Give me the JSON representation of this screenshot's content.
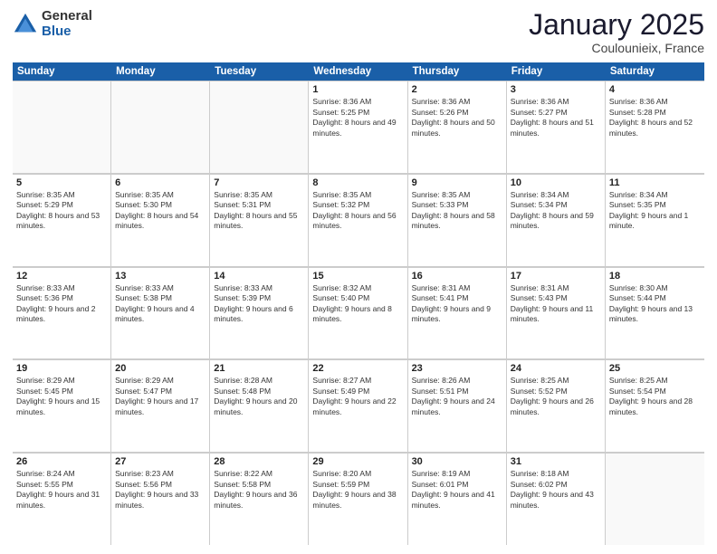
{
  "logo": {
    "general": "General",
    "blue": "Blue"
  },
  "header": {
    "month": "January 2025",
    "location": "Coulounieix, France"
  },
  "weekdays": [
    "Sunday",
    "Monday",
    "Tuesday",
    "Wednesday",
    "Thursday",
    "Friday",
    "Saturday"
  ],
  "rows": [
    [
      {
        "day": "",
        "sunrise": "",
        "sunset": "",
        "daylight": ""
      },
      {
        "day": "",
        "sunrise": "",
        "sunset": "",
        "daylight": ""
      },
      {
        "day": "",
        "sunrise": "",
        "sunset": "",
        "daylight": ""
      },
      {
        "day": "1",
        "sunrise": "Sunrise: 8:36 AM",
        "sunset": "Sunset: 5:25 PM",
        "daylight": "Daylight: 8 hours and 49 minutes."
      },
      {
        "day": "2",
        "sunrise": "Sunrise: 8:36 AM",
        "sunset": "Sunset: 5:26 PM",
        "daylight": "Daylight: 8 hours and 50 minutes."
      },
      {
        "day": "3",
        "sunrise": "Sunrise: 8:36 AM",
        "sunset": "Sunset: 5:27 PM",
        "daylight": "Daylight: 8 hours and 51 minutes."
      },
      {
        "day": "4",
        "sunrise": "Sunrise: 8:36 AM",
        "sunset": "Sunset: 5:28 PM",
        "daylight": "Daylight: 8 hours and 52 minutes."
      }
    ],
    [
      {
        "day": "5",
        "sunrise": "Sunrise: 8:35 AM",
        "sunset": "Sunset: 5:29 PM",
        "daylight": "Daylight: 8 hours and 53 minutes."
      },
      {
        "day": "6",
        "sunrise": "Sunrise: 8:35 AM",
        "sunset": "Sunset: 5:30 PM",
        "daylight": "Daylight: 8 hours and 54 minutes."
      },
      {
        "day": "7",
        "sunrise": "Sunrise: 8:35 AM",
        "sunset": "Sunset: 5:31 PM",
        "daylight": "Daylight: 8 hours and 55 minutes."
      },
      {
        "day": "8",
        "sunrise": "Sunrise: 8:35 AM",
        "sunset": "Sunset: 5:32 PM",
        "daylight": "Daylight: 8 hours and 56 minutes."
      },
      {
        "day": "9",
        "sunrise": "Sunrise: 8:35 AM",
        "sunset": "Sunset: 5:33 PM",
        "daylight": "Daylight: 8 hours and 58 minutes."
      },
      {
        "day": "10",
        "sunrise": "Sunrise: 8:34 AM",
        "sunset": "Sunset: 5:34 PM",
        "daylight": "Daylight: 8 hours and 59 minutes."
      },
      {
        "day": "11",
        "sunrise": "Sunrise: 8:34 AM",
        "sunset": "Sunset: 5:35 PM",
        "daylight": "Daylight: 9 hours and 1 minute."
      }
    ],
    [
      {
        "day": "12",
        "sunrise": "Sunrise: 8:33 AM",
        "sunset": "Sunset: 5:36 PM",
        "daylight": "Daylight: 9 hours and 2 minutes."
      },
      {
        "day": "13",
        "sunrise": "Sunrise: 8:33 AM",
        "sunset": "Sunset: 5:38 PM",
        "daylight": "Daylight: 9 hours and 4 minutes."
      },
      {
        "day": "14",
        "sunrise": "Sunrise: 8:33 AM",
        "sunset": "Sunset: 5:39 PM",
        "daylight": "Daylight: 9 hours and 6 minutes."
      },
      {
        "day": "15",
        "sunrise": "Sunrise: 8:32 AM",
        "sunset": "Sunset: 5:40 PM",
        "daylight": "Daylight: 9 hours and 8 minutes."
      },
      {
        "day": "16",
        "sunrise": "Sunrise: 8:31 AM",
        "sunset": "Sunset: 5:41 PM",
        "daylight": "Daylight: 9 hours and 9 minutes."
      },
      {
        "day": "17",
        "sunrise": "Sunrise: 8:31 AM",
        "sunset": "Sunset: 5:43 PM",
        "daylight": "Daylight: 9 hours and 11 minutes."
      },
      {
        "day": "18",
        "sunrise": "Sunrise: 8:30 AM",
        "sunset": "Sunset: 5:44 PM",
        "daylight": "Daylight: 9 hours and 13 minutes."
      }
    ],
    [
      {
        "day": "19",
        "sunrise": "Sunrise: 8:29 AM",
        "sunset": "Sunset: 5:45 PM",
        "daylight": "Daylight: 9 hours and 15 minutes."
      },
      {
        "day": "20",
        "sunrise": "Sunrise: 8:29 AM",
        "sunset": "Sunset: 5:47 PM",
        "daylight": "Daylight: 9 hours and 17 minutes."
      },
      {
        "day": "21",
        "sunrise": "Sunrise: 8:28 AM",
        "sunset": "Sunset: 5:48 PM",
        "daylight": "Daylight: 9 hours and 20 minutes."
      },
      {
        "day": "22",
        "sunrise": "Sunrise: 8:27 AM",
        "sunset": "Sunset: 5:49 PM",
        "daylight": "Daylight: 9 hours and 22 minutes."
      },
      {
        "day": "23",
        "sunrise": "Sunrise: 8:26 AM",
        "sunset": "Sunset: 5:51 PM",
        "daylight": "Daylight: 9 hours and 24 minutes."
      },
      {
        "day": "24",
        "sunrise": "Sunrise: 8:25 AM",
        "sunset": "Sunset: 5:52 PM",
        "daylight": "Daylight: 9 hours and 26 minutes."
      },
      {
        "day": "25",
        "sunrise": "Sunrise: 8:25 AM",
        "sunset": "Sunset: 5:54 PM",
        "daylight": "Daylight: 9 hours and 28 minutes."
      }
    ],
    [
      {
        "day": "26",
        "sunrise": "Sunrise: 8:24 AM",
        "sunset": "Sunset: 5:55 PM",
        "daylight": "Daylight: 9 hours and 31 minutes."
      },
      {
        "day": "27",
        "sunrise": "Sunrise: 8:23 AM",
        "sunset": "Sunset: 5:56 PM",
        "daylight": "Daylight: 9 hours and 33 minutes."
      },
      {
        "day": "28",
        "sunrise": "Sunrise: 8:22 AM",
        "sunset": "Sunset: 5:58 PM",
        "daylight": "Daylight: 9 hours and 36 minutes."
      },
      {
        "day": "29",
        "sunrise": "Sunrise: 8:20 AM",
        "sunset": "Sunset: 5:59 PM",
        "daylight": "Daylight: 9 hours and 38 minutes."
      },
      {
        "day": "30",
        "sunrise": "Sunrise: 8:19 AM",
        "sunset": "Sunset: 6:01 PM",
        "daylight": "Daylight: 9 hours and 41 minutes."
      },
      {
        "day": "31",
        "sunrise": "Sunrise: 8:18 AM",
        "sunset": "Sunset: 6:02 PM",
        "daylight": "Daylight: 9 hours and 43 minutes."
      },
      {
        "day": "",
        "sunrise": "",
        "sunset": "",
        "daylight": ""
      }
    ]
  ]
}
